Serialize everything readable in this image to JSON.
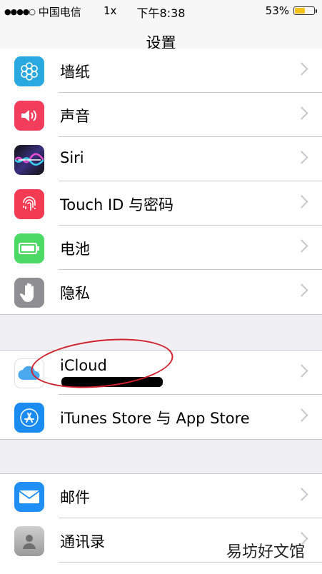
{
  "status_bar": {
    "signal_dots": "●●●●○",
    "carrier": "中国电信",
    "network_speed": "1x",
    "time": "下午8:38",
    "battery_percent": "53%",
    "battery_level": 0.53,
    "battery_color": "#f5c21a"
  },
  "nav": {
    "title": "设置"
  },
  "group1": {
    "items": [
      {
        "label": "墙纸",
        "icon": "wallpaper-icon",
        "color": "#2aa9e0"
      },
      {
        "label": "声音",
        "icon": "speaker-icon",
        "color": "#f23d5d"
      },
      {
        "label": "Siri",
        "icon": "siri-icon",
        "color": "#1d1f4a"
      },
      {
        "label": "Touch ID 与密码",
        "icon": "fingerprint-icon",
        "color": "#f33c54"
      },
      {
        "label": "电池",
        "icon": "battery-icon",
        "color": "#4cd964"
      },
      {
        "label": "隐私",
        "icon": "hand-icon",
        "color": "#8e8e93"
      }
    ]
  },
  "group2": {
    "items": [
      {
        "label": "iCloud",
        "icon": "icloud-icon",
        "color": "#ffffff"
      },
      {
        "label": "iTunes Store 与 App Store",
        "icon": "app-store-icon",
        "color": "#1a8bf0"
      }
    ]
  },
  "group3": {
    "items": [
      {
        "label": "邮件",
        "icon": "mail-icon",
        "color": "#1f8ff5"
      },
      {
        "label": "通讯录",
        "icon": "contacts-icon",
        "color": "#a9a9a9"
      }
    ]
  },
  "watermark": "易坊好文馆"
}
